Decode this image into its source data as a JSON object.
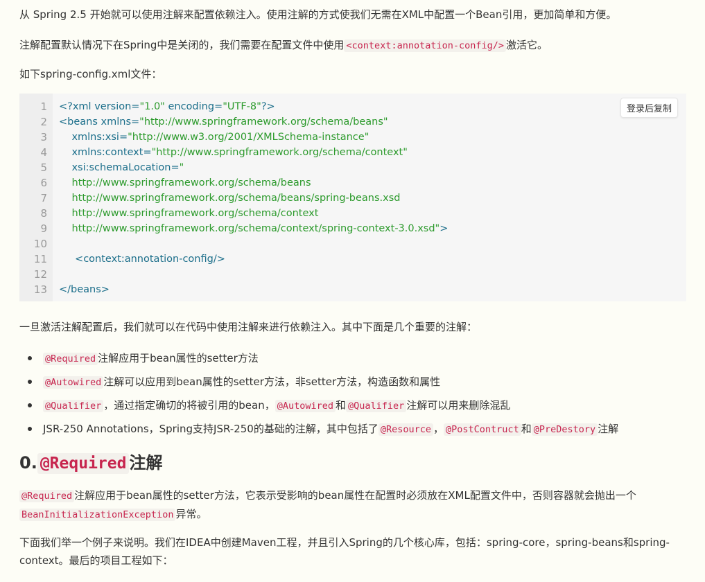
{
  "intro": {
    "p1": "从 Spring 2.5 开始就可以使用注解来配置依赖注入。使用注解的方式使我们无需在XML中配置一个Bean引用，更加简单和方便。",
    "p2_before": "注解配置默认情况下在Spring中是关闭的，我们需要在配置文件中使用",
    "p2_code": "<context:annotation-config/>",
    "p2_after": "激活它。",
    "p3": "如下spring-config.xml文件："
  },
  "code_block": {
    "copy_label": "登录后复制",
    "lines": [
      {
        "n": "1",
        "indent": "",
        "parts": [
          {
            "t": "tag",
            "v": "<?xml version="
          },
          {
            "t": "str",
            "v": "\"1.0\""
          },
          {
            "t": "tag",
            "v": " encoding="
          },
          {
            "t": "str",
            "v": "\"UTF-8\""
          },
          {
            "t": "tag",
            "v": "?>"
          }
        ]
      },
      {
        "n": "2",
        "indent": "",
        "parts": [
          {
            "t": "tag",
            "v": "<beans xmlns="
          },
          {
            "t": "str",
            "v": "\"http://www.springframework.org/schema/beans\""
          }
        ]
      },
      {
        "n": "3",
        "indent": "    ",
        "parts": [
          {
            "t": "tag",
            "v": "xmlns:xsi="
          },
          {
            "t": "str",
            "v": "\"http://www.w3.org/2001/XMLSchema-instance\""
          }
        ]
      },
      {
        "n": "4",
        "indent": "    ",
        "parts": [
          {
            "t": "tag",
            "v": "xmlns:context="
          },
          {
            "t": "str",
            "v": "\"http://www.springframework.org/schema/context\""
          }
        ]
      },
      {
        "n": "5",
        "indent": "    ",
        "parts": [
          {
            "t": "tag",
            "v": "xsi:schemaLocation="
          },
          {
            "t": "str",
            "v": "\""
          }
        ]
      },
      {
        "n": "6",
        "indent": "    ",
        "parts": [
          {
            "t": "str",
            "v": "http://www.springframework.org/schema/beans"
          }
        ]
      },
      {
        "n": "7",
        "indent": "    ",
        "parts": [
          {
            "t": "str",
            "v": "http://www.springframework.org/schema/beans/spring-beans.xsd"
          }
        ]
      },
      {
        "n": "8",
        "indent": "    ",
        "parts": [
          {
            "t": "str",
            "v": "http://www.springframework.org/schema/context"
          }
        ]
      },
      {
        "n": "9",
        "indent": "    ",
        "parts": [
          {
            "t": "str",
            "v": "http://www.springframework.org/schema/context/spring-context-3.0.xsd\""
          },
          {
            "t": "tag",
            "v": ">"
          }
        ]
      },
      {
        "n": "10",
        "indent": "",
        "parts": []
      },
      {
        "n": "11",
        "indent": "     ",
        "parts": [
          {
            "t": "tag",
            "v": "<context:annotation-config/>"
          }
        ]
      },
      {
        "n": "12",
        "indent": "",
        "parts": []
      },
      {
        "n": "13",
        "indent": "",
        "parts": [
          {
            "t": "tag",
            "v": "</beans>"
          }
        ]
      }
    ]
  },
  "after_code": "一旦激活注解配置后，我们就可以在代码中使用注解来进行依赖注入。其中下面是几个重要的注解：",
  "bullets": [
    {
      "parts": [
        {
          "t": "code",
          "v": "@Required"
        },
        {
          "t": "text",
          "v": "注解应用于bean属性的setter方法"
        }
      ]
    },
    {
      "parts": [
        {
          "t": "code",
          "v": "@Autowired"
        },
        {
          "t": "text",
          "v": "注解可以应用到bean属性的setter方法，非setter方法，构造函数和属性"
        }
      ]
    },
    {
      "parts": [
        {
          "t": "code",
          "v": "@Qualifier"
        },
        {
          "t": "text",
          "v": "，通过指定确切的将被引用的bean，"
        },
        {
          "t": "code",
          "v": "@Autowired"
        },
        {
          "t": "text",
          "v": "和"
        },
        {
          "t": "code",
          "v": "@Qualifier"
        },
        {
          "t": "text",
          "v": "注解可以用来删除混乱"
        }
      ]
    },
    {
      "parts": [
        {
          "t": "text",
          "v": "JSR-250 Annotations，Spring支持JSR-250的基础的注解，其中包括了"
        },
        {
          "t": "code",
          "v": "@Resource"
        },
        {
          "t": "text",
          "v": "，"
        },
        {
          "t": "code",
          "v": "@PostContruct"
        },
        {
          "t": "text",
          "v": "和"
        },
        {
          "t": "code",
          "v": "@PreDestory"
        },
        {
          "t": "text",
          "v": "注解"
        }
      ]
    }
  ],
  "section": {
    "prefix": "0.",
    "code": "@Required",
    "suffix": "注解"
  },
  "section_p1": {
    "code1": "@Required",
    "text1": "注解应用于bean属性的setter方法，它表示受影响的bean属性在配置时必须放在XML配置文件中，否则容器就会抛出一个",
    "code2": "BeanInitializationException",
    "text2": "异常。"
  },
  "section_p2": "下面我们举一个例子来说明。我们在IDEA中创建Maven工程，并且引入Spring的几个核心库，包括：spring-core，spring-beans和spring-context。最后的项目工程如下："
}
